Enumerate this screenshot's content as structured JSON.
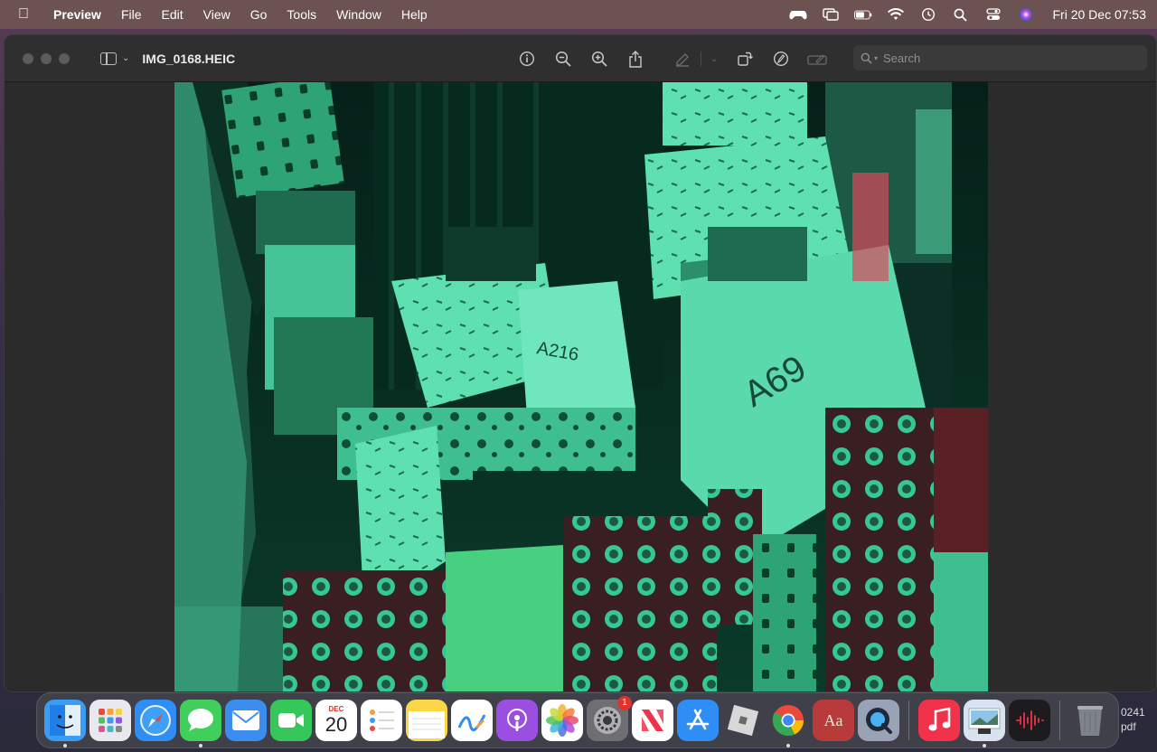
{
  "menubar": {
    "app_name": "Preview",
    "items": [
      "File",
      "Edit",
      "View",
      "Go",
      "Tools",
      "Window",
      "Help"
    ],
    "clock": "Fri 20 Dec  07:53",
    "battery_level": 0.65
  },
  "window": {
    "document_title": "IMG_0168.HEIC",
    "search_placeholder": "Search"
  },
  "dock": {
    "apps": [
      {
        "name": "Finder",
        "icon": "finder-icon",
        "color": "#3b9cf5",
        "running": true
      },
      {
        "name": "Launchpad",
        "icon": "launchpad-icon",
        "color": "#e8e8ee",
        "running": false
      },
      {
        "name": "Safari",
        "icon": "safari-icon",
        "color": "#2f8ef5",
        "running": false
      },
      {
        "name": "Messages",
        "icon": "messages-icon",
        "color": "#3fcf5a",
        "running": true
      },
      {
        "name": "Mail",
        "icon": "mail-icon",
        "color": "#3b8ef0",
        "running": false
      },
      {
        "name": "FaceTime",
        "icon": "facetime-icon",
        "color": "#35c759",
        "running": false
      },
      {
        "name": "Calendar",
        "icon": "calendar-icon",
        "color": "#ffffff",
        "running": false,
        "month": "DEC",
        "day": "20"
      },
      {
        "name": "Reminders",
        "icon": "reminders-icon",
        "color": "#ffffff",
        "running": false
      },
      {
        "name": "Notes",
        "icon": "notes-icon",
        "color": "#fbd748",
        "running": false
      },
      {
        "name": "Freeform",
        "icon": "freeform-icon",
        "color": "#ffffff",
        "running": false
      },
      {
        "name": "Podcasts",
        "icon": "podcasts-icon",
        "color": "#9a4fe0",
        "running": false
      },
      {
        "name": "Photos",
        "icon": "photos-icon",
        "color": "#ffffff",
        "running": false
      },
      {
        "name": "System Settings",
        "icon": "settings-icon",
        "color": "#6e6e73",
        "running": false,
        "badge": "1"
      },
      {
        "name": "News",
        "icon": "news-icon",
        "color": "#ffffff",
        "running": false
      },
      {
        "name": "App Store",
        "icon": "appstore-icon",
        "color": "#2f8ef5",
        "running": false
      },
      {
        "name": "Roblox",
        "icon": "roblox-icon",
        "color": "#d8d8d8",
        "running": false
      },
      {
        "name": "Chrome",
        "icon": "chrome-icon",
        "color": "#ffffff",
        "running": true
      },
      {
        "name": "Dictionary",
        "icon": "dictionary-icon",
        "color": "#b83a3a",
        "running": false
      },
      {
        "name": "QuickTime",
        "icon": "quicktime-icon",
        "color": "#9aa3b5",
        "running": false
      }
    ],
    "recent_apps": [
      {
        "name": "Music",
        "icon": "music-icon",
        "color": "#f0334b",
        "running": false
      },
      {
        "name": "Preview",
        "icon": "preview-icon",
        "color": "#d9e3ef",
        "running": true
      },
      {
        "name": "Voice Memos",
        "icon": "voicememos-icon",
        "color": "#1c1c1e",
        "running": false
      }
    ],
    "trash": {
      "name": "Trash",
      "icon": "trash-icon"
    }
  },
  "desktop_file": {
    "line1": "0241",
    "line2": "pdf"
  }
}
